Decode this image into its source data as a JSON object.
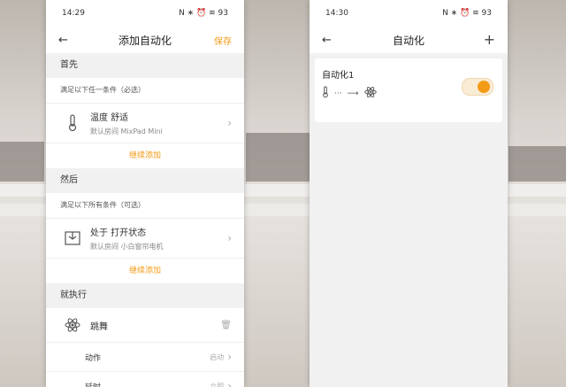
{
  "colors": {
    "accent": "#f39b16"
  },
  "left_phone": {
    "status": {
      "time": "14:29",
      "icons": "N ∗ ⏰ ≋ 93"
    },
    "nav": {
      "back_icon": "back-arrow-icon",
      "title": "添加自动化",
      "save_label": "保存"
    },
    "sections": {
      "first": {
        "title": "首先",
        "subtitle": "满足以下任一条件（必选）",
        "condition": {
          "main": "温度 舒适",
          "sub": "默认房间 MixPad Mini",
          "icon": "thermometer-icon"
        },
        "add_more": "继续添加"
      },
      "then": {
        "title": "然后",
        "subtitle": "满足以下所有条件（可选）",
        "condition": {
          "main": "处于 打开状态",
          "sub": "默认房间 小白窗帘电机",
          "icon": "curtain-icon"
        },
        "add_more": "继续添加"
      },
      "execute": {
        "title": "就执行",
        "action_item": {
          "label": "跳舞",
          "icon": "atom-icon"
        },
        "action_row": {
          "label": "动作",
          "value": "启动"
        },
        "delay_row": {
          "label": "延时",
          "value": "立即"
        }
      }
    }
  },
  "right_phone": {
    "status": {
      "time": "14:30",
      "icons": "N ∗ ⏰ ≋ 93"
    },
    "nav": {
      "back_icon": "back-arrow-icon",
      "title": "自动化",
      "add_icon": "plus-icon"
    },
    "automation": {
      "name": "自动化1",
      "enabled": true
    }
  }
}
